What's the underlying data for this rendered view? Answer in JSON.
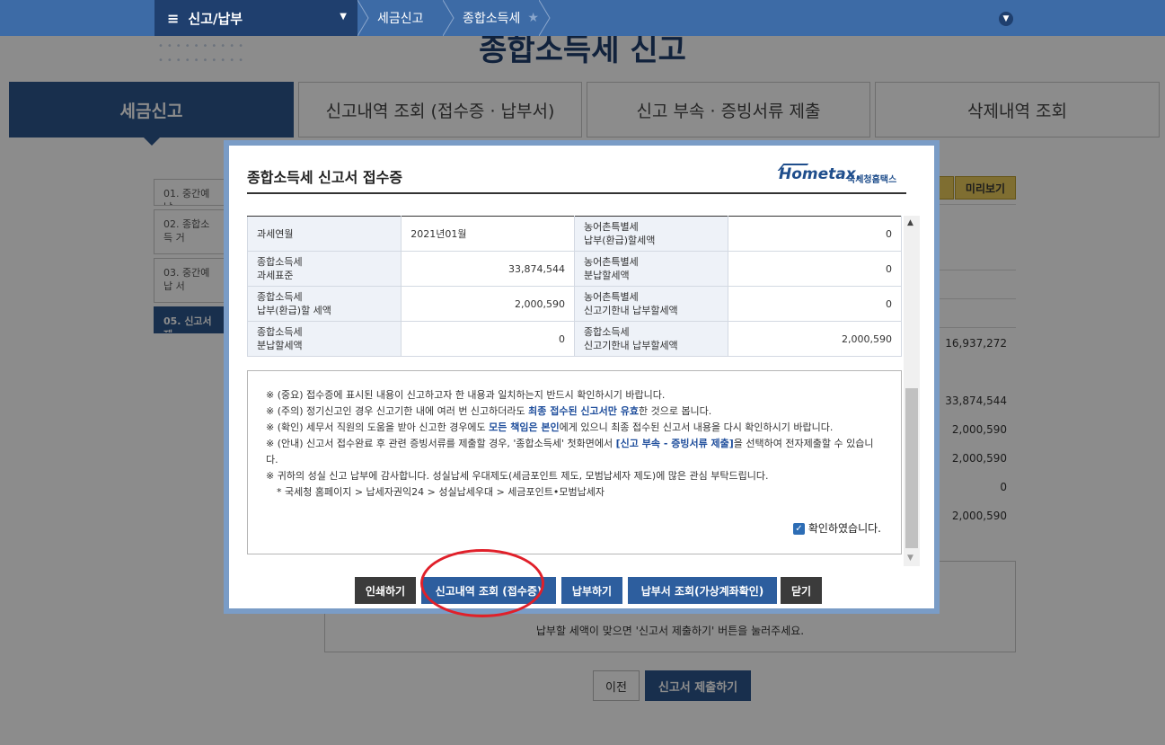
{
  "topbar": {
    "menu_label": "신고/납부",
    "breadcrumb": [
      "세금신고",
      "종합소득세"
    ]
  },
  "page": {
    "title": "종합소득세 신고",
    "tabs": [
      "세금신고",
      "신고내역 조회 (접수증 · 납부서)",
      "신고 부속 · 증빙서류 제출",
      "삭제내역 조회"
    ],
    "steps": [
      "01. 중간예납",
      "02. 종합소득 거",
      "03. 중간예납 서",
      "05. 신고서 제"
    ],
    "preview_label": "미리보기",
    "side_values": [
      "16,937,272",
      "33,874,544",
      "2,000,590",
      "2,000,590",
      "0",
      "2,000,590"
    ],
    "bottom_message": "납부할 세액이 맞으면 '신고서 제출하기' 버튼을 눌러주세요.",
    "prev_label": "이전",
    "submit_label": "신고서 제출하기"
  },
  "modal": {
    "title": "종합소득세 신고서 접수증",
    "logo_mark": "Hometax.",
    "logo_kor": "국세청홈택스",
    "rows": [
      {
        "l1": "과세연월",
        "v1": "2021년01월",
        "l2": "농어촌특별세\n납부(환급)할세액",
        "v2": "0"
      },
      {
        "l1": "종합소득세\n과세표준",
        "v1": "33,874,544",
        "l2": "농어촌특별세\n분납할세액",
        "v2": "0"
      },
      {
        "l1": "종합소득세\n납부(환급)할 세액",
        "v1": "2,000,590",
        "l2": "농어촌특별세\n신고기한내 납부할세액",
        "v2": "0"
      },
      {
        "l1": "종합소득세\n분납할세액",
        "v1": "0",
        "l2": "종합소득세\n신고기한내 납부할세액",
        "v2": "2,000,590"
      }
    ],
    "notice": {
      "n1": "※ (중요) 접수증에 표시된 내용이 신고하고자 한 내용과 일치하는지 반드시 확인하시기 바랍니다.",
      "n2a": "※ (주의) 정기신고인 경우 신고기한 내에 여러 번 신고하더라도 ",
      "n2b": "최종 접수된 신고서만 유효",
      "n2c": "한 것으로 봅니다.",
      "n3a": "※ (확인) 세무서 직원의 도움을 받아 신고한 경우에도 ",
      "n3b": "모든 책임은 본인",
      "n3c": "에게 있으니 최종 접수된 신고서 내용을 다시 확인하시기 바랍니다.",
      "n4a": "※ (안내) 신고서 접수완료 후 관련 증빙서류를 제출할 경우, '종합소득세' 첫화면에서 ",
      "n4b": "[신고 부속 - 증빙서류 제출]",
      "n4c": "을 선택하여 전자제출할 수 있습니다.",
      "n5": "※ 귀하의 성실 신고 납부에 감사합니다. 성실납세 우대제도(세금포인트 제도, 모범납세자 제도)에 많은 관심 부탁드립니다.",
      "n6": "* 국세청 홈페이지 > 납세자권익24 > 성실납세우대 > 세금포인트•모범납세자"
    },
    "confirm_label": "확인하였습니다.",
    "buttons": {
      "print": "인쇄하기",
      "history": "신고내역 조회 (접수증)",
      "pay": "납부하기",
      "bill": "납부서 조회(가상계좌확인)",
      "close": "닫기"
    }
  }
}
